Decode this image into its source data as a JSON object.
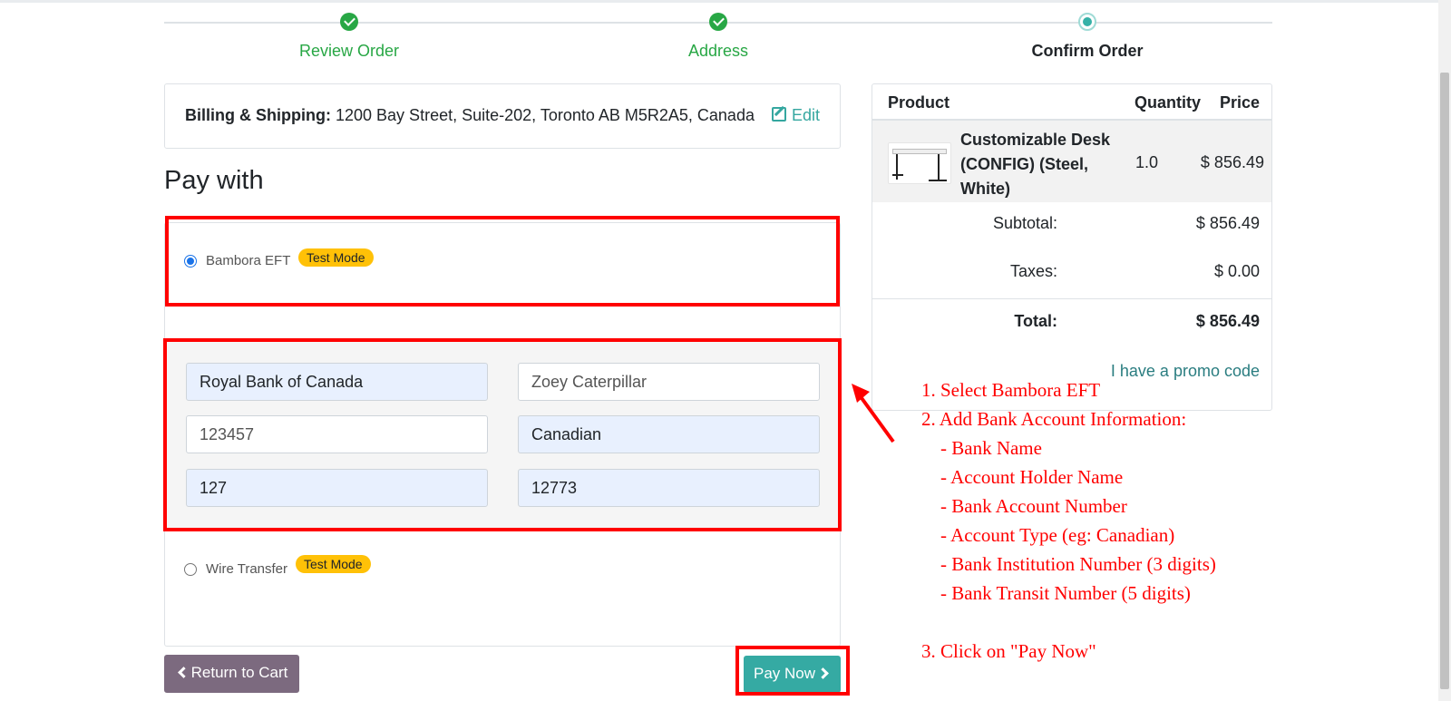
{
  "steps": [
    {
      "label": "Review Order",
      "state": "done"
    },
    {
      "label": "Address",
      "state": "done"
    },
    {
      "label": "Confirm Order",
      "state": "current"
    }
  ],
  "billing": {
    "label": "Billing & Shipping:",
    "address": "1200 Bay Street, Suite-202, Toronto AB M5R2A5, Canada",
    "edit": "Edit"
  },
  "pay_with": "Pay with",
  "acquirers": [
    {
      "name": "Bambora EFT",
      "badge": "Test Mode",
      "selected": true
    },
    {
      "name": "Wire Transfer",
      "badge": "Test Mode",
      "selected": false
    }
  ],
  "form": {
    "bank_name": "Royal Bank of Canada",
    "holder_name": "Zoey Caterpillar",
    "account_number": "123457",
    "account_type": "Canadian",
    "institution_number": "127",
    "transit_number": "12773"
  },
  "buttons": {
    "return": "Return to Cart",
    "pay": "Pay Now"
  },
  "summary": {
    "headers": {
      "product": "Product",
      "quantity": "Quantity",
      "price": "Price"
    },
    "item": {
      "name": "Customizable Desk (CONFIG) (Steel, White)",
      "qty": "1.0",
      "price": "$ 856.49"
    },
    "subtotal_label": "Subtotal:",
    "subtotal": "$ 856.49",
    "taxes_label": "Taxes:",
    "taxes": "$ 0.00",
    "total_label": "Total:",
    "total": "$ 856.49",
    "promo": "I have a promo code"
  },
  "annotations": {
    "lines": [
      "1. Select Bambora EFT",
      "2. Add Bank Account Information:",
      "    - Bank Name",
      "    - Account Holder Name",
      "    - Bank Account Number",
      "    - Account Type (eg: Canadian)",
      "    - Bank Institution Number (3 digits)",
      "    - Bank Transit Number (5 digits)"
    ],
    "step3": "3. Click on \"Pay Now\""
  },
  "colors": {
    "success": "#28a745",
    "primary": "#35aaa3",
    "secondary": "#7c6a7f",
    "badge": "#ffc107",
    "annotation": "#ff0000"
  }
}
